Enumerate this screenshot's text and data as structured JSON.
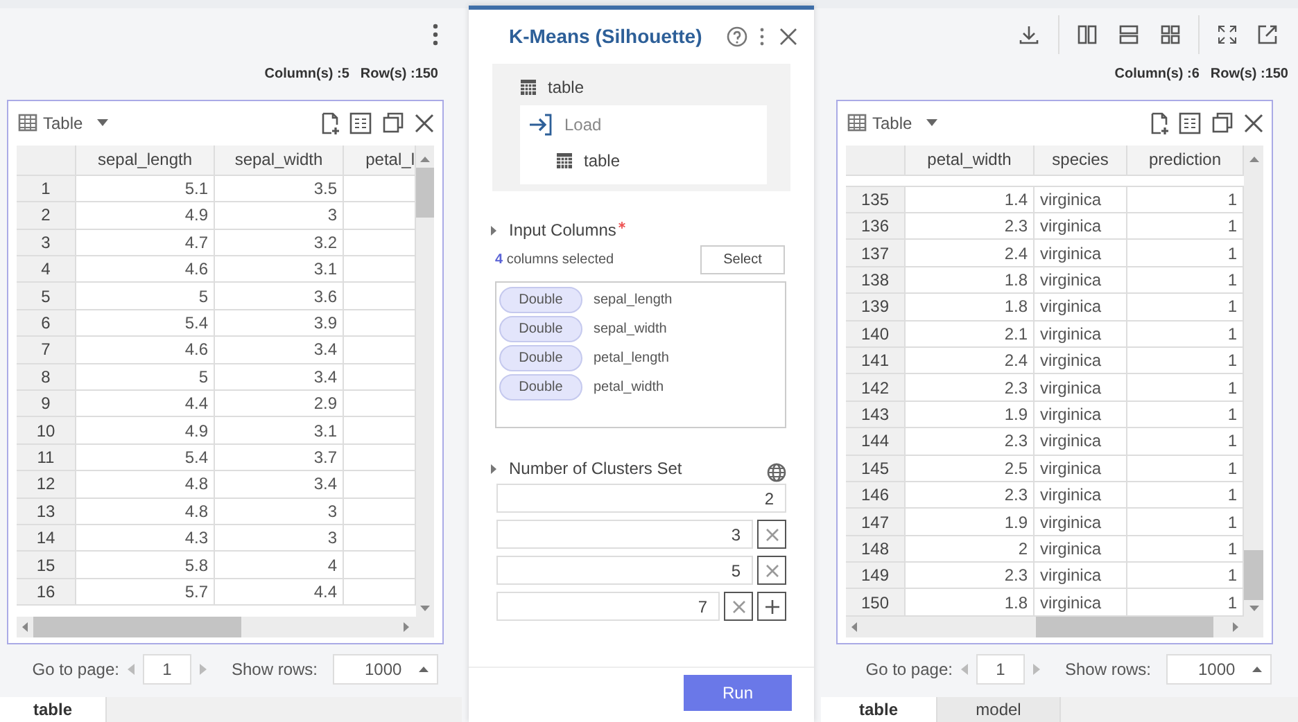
{
  "left_panel": {
    "summary": {
      "columns": "Column(s) :5",
      "rows": "Row(s) :150"
    },
    "table_view": {
      "view_label": "Table",
      "columns": [
        "",
        "sepal_length",
        "sepal_width",
        "petal_l"
      ],
      "rows": [
        [
          "1",
          "5.1",
          "3.5"
        ],
        [
          "2",
          "4.9",
          "3"
        ],
        [
          "3",
          "4.7",
          "3.2"
        ],
        [
          "4",
          "4.6",
          "3.1"
        ],
        [
          "5",
          "5",
          "3.6"
        ],
        [
          "6",
          "5.4",
          "3.9"
        ],
        [
          "7",
          "4.6",
          "3.4"
        ],
        [
          "8",
          "5",
          "3.4"
        ],
        [
          "9",
          "4.4",
          "2.9"
        ],
        [
          "10",
          "4.9",
          "3.1"
        ],
        [
          "11",
          "5.4",
          "3.7"
        ],
        [
          "12",
          "4.8",
          "3.4"
        ],
        [
          "13",
          "4.8",
          "3"
        ],
        [
          "14",
          "4.3",
          "3"
        ],
        [
          "15",
          "5.8",
          "4"
        ],
        [
          "16",
          "5.7",
          "4.4"
        ]
      ]
    },
    "pagination": {
      "go_to_label": "Go to page:",
      "page": "1",
      "rows_label": "Show rows:",
      "rows_per_page": "1000"
    },
    "tabs": [
      {
        "label": "table",
        "selected": true
      }
    ]
  },
  "dialog": {
    "title": "K-Means (Silhouette)",
    "tree": [
      {
        "label": "table",
        "kind": "table",
        "children": [
          {
            "label": "Load",
            "kind": "load",
            "children": [
              {
                "label": "table",
                "kind": "table"
              }
            ]
          }
        ]
      }
    ],
    "input_columns": {
      "label": "Input Columns",
      "required": true,
      "count": "4",
      "count_text": "columns selected",
      "select_button": "Select",
      "items": [
        {
          "type": "Double",
          "name": "sepal_length"
        },
        {
          "type": "Double",
          "name": "sepal_width"
        },
        {
          "type": "Double",
          "name": "petal_length"
        },
        {
          "type": "Double",
          "name": "petal_width"
        }
      ]
    },
    "clusters": {
      "label": "Number of Clusters Set",
      "can_add": true,
      "values": [
        {
          "value": "2",
          "removable": false
        },
        {
          "value": "3",
          "removable": true
        },
        {
          "value": "5",
          "removable": true
        },
        {
          "value": "7",
          "removable": true
        }
      ]
    },
    "run_button": "Run"
  },
  "right_panel": {
    "summary": {
      "columns": "Column(s) :6",
      "rows": "Row(s) :150"
    },
    "table_view": {
      "view_label": "Table",
      "columns": [
        "",
        "petal_width",
        "species",
        "prediction"
      ],
      "rows": [
        [
          "135",
          "1.4",
          "virginica",
          "1"
        ],
        [
          "136",
          "2.3",
          "virginica",
          "1"
        ],
        [
          "137",
          "2.4",
          "virginica",
          "1"
        ],
        [
          "138",
          "1.8",
          "virginica",
          "1"
        ],
        [
          "139",
          "1.8",
          "virginica",
          "1"
        ],
        [
          "140",
          "2.1",
          "virginica",
          "1"
        ],
        [
          "141",
          "2.4",
          "virginica",
          "1"
        ],
        [
          "142",
          "2.3",
          "virginica",
          "1"
        ],
        [
          "143",
          "1.9",
          "virginica",
          "1"
        ],
        [
          "144",
          "2.3",
          "virginica",
          "1"
        ],
        [
          "145",
          "2.5",
          "virginica",
          "1"
        ],
        [
          "146",
          "2.3",
          "virginica",
          "1"
        ],
        [
          "147",
          "1.9",
          "virginica",
          "1"
        ],
        [
          "148",
          "2",
          "virginica",
          "1"
        ],
        [
          "149",
          "2.3",
          "virginica",
          "1"
        ],
        [
          "150",
          "1.8",
          "virginica",
          "1"
        ]
      ]
    },
    "pagination": {
      "go_to_label": "Go to page:",
      "page": "1",
      "rows_label": "Show rows:",
      "rows_per_page": "1000"
    },
    "tabs": [
      {
        "label": "table",
        "selected": true
      },
      {
        "label": "model",
        "selected": false
      }
    ]
  }
}
